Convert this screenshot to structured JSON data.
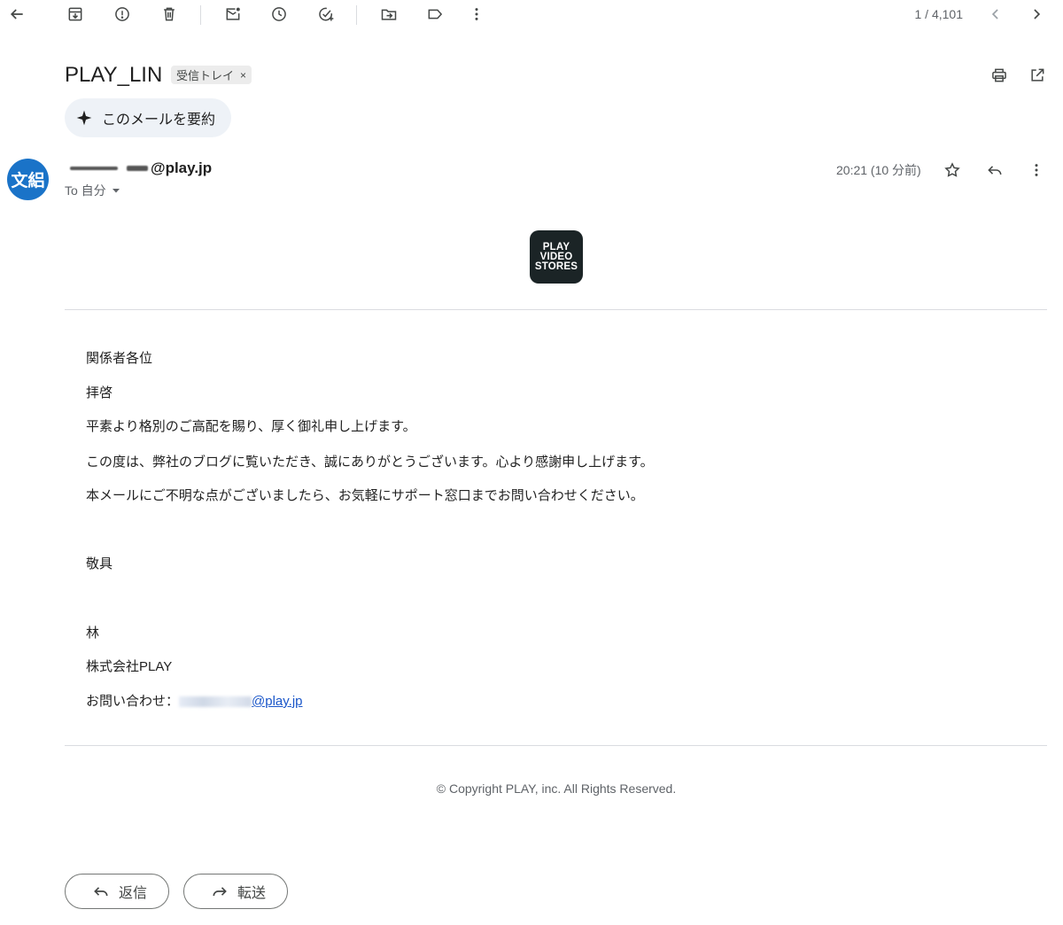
{
  "toolbar": {
    "counter": "1 / 4,101",
    "icons": [
      "back-arrow-icon",
      "archive-icon",
      "report-spam-icon",
      "delete-icon",
      "mark-unread-icon",
      "snooze-icon",
      "add-to-tasks-icon",
      "move-to-icon",
      "label-icon",
      "more-vert-icon",
      "prev-chevron-icon",
      "next-chevron-icon"
    ]
  },
  "subject": {
    "title": "PLAY_LIN",
    "label": "受信トレイ",
    "label_remove": "×"
  },
  "summary_button": {
    "label": "このメールを要約"
  },
  "sender": {
    "avatar_text": "文絽",
    "email_suffix": "@play.jp",
    "to_line": "To 自分",
    "timestamp": "20:21 (10 分前)"
  },
  "logo": {
    "lines": [
      "PLAY",
      "VIDEO",
      "STORES"
    ]
  },
  "body": {
    "greeting": "関係者各位",
    "opening": "拝啓",
    "para1": "平素より格別のご高配を賜り、厚く御礼申し上げます。",
    "para2": "この度は、弊社のブログに覧いただき、誠にありがとうございます。心より感謝申し上げます。",
    "para3": "本メールにご不明な点がございましたら、お気軽にサポート窓口までお問い合わせください。",
    "closing": "敬具",
    "sig_name": "林",
    "sig_company": "株式会社PLAY",
    "contact_label": "お問い合わせ：",
    "contact_email_suffix": "@play.jp"
  },
  "footer": {
    "copyright": "© Copyright PLAY, inc. All Rights Reserved."
  },
  "actions": {
    "reply": "返信",
    "forward": "転送"
  },
  "colors": {
    "avatar": "#1a73c8",
    "link": "#1a56c9",
    "summary_bg": "#eef2f7",
    "logo_bg": "#1b2426"
  }
}
